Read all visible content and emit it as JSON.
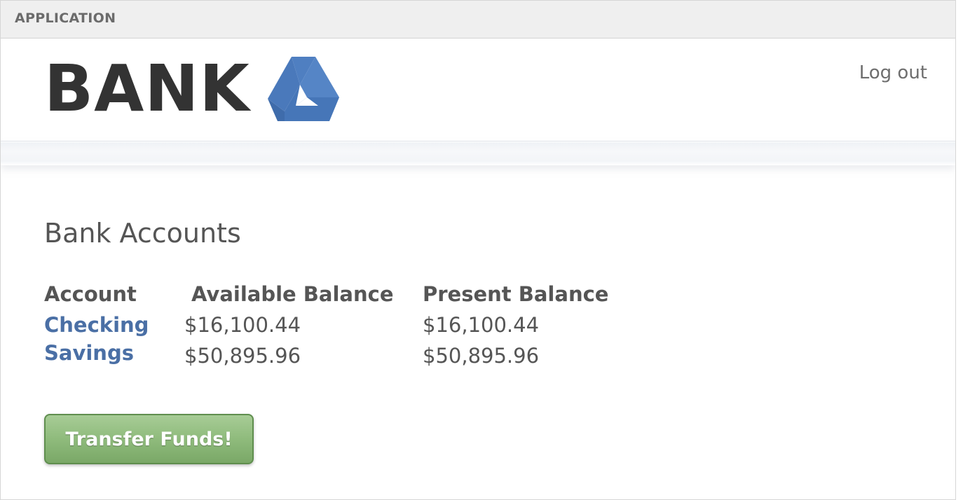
{
  "window": {
    "title": "APPLICATION"
  },
  "header": {
    "logo_text": "BANK",
    "logo_icon": "triangle-logo-icon",
    "logout_label": "Log out"
  },
  "main": {
    "title": "Bank Accounts",
    "table": {
      "columns": [
        "Account",
        "Available Balance",
        "Present Balance"
      ],
      "rows": [
        {
          "account": "Checking",
          "available": "$16,100.44",
          "present": "$16,100.44"
        },
        {
          "account": "Savings",
          "available": "$50,895.96",
          "present": "$50,895.96"
        }
      ]
    },
    "transfer_label": "Transfer Funds!"
  },
  "colors": {
    "link": "#4a6fa5",
    "text": "#555555",
    "button_green": "#8fbb7c",
    "logo_blue": "#4f7fc1"
  }
}
